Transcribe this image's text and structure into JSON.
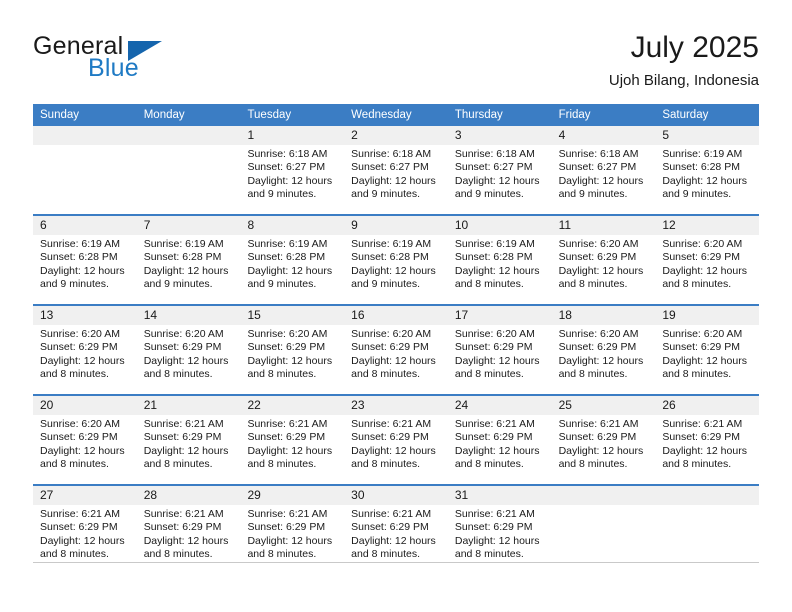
{
  "brand": {
    "name_top": "General",
    "name_bottom": "Blue",
    "triangle_icon": "triangle-icon",
    "color_dark": "#1a1a1a",
    "color_blue": "#1f7ac4"
  },
  "header": {
    "title": "July 2025",
    "subtitle": "Ujoh Bilang, Indonesia"
  },
  "calendar": {
    "header_bg": "#3b7dc4",
    "day_band_bg": "#f0f0f0",
    "weekdays": [
      "Sunday",
      "Monday",
      "Tuesday",
      "Wednesday",
      "Thursday",
      "Friday",
      "Saturday"
    ],
    "weeks": [
      [
        {
          "day": "",
          "sunrise": "",
          "sunset": "",
          "daylight_line1": "",
          "daylight_line2": ""
        },
        {
          "day": "",
          "sunrise": "",
          "sunset": "",
          "daylight_line1": "",
          "daylight_line2": ""
        },
        {
          "day": "1",
          "sunrise": "Sunrise: 6:18 AM",
          "sunset": "Sunset: 6:27 PM",
          "daylight_line1": "Daylight: 12 hours",
          "daylight_line2": "and 9 minutes."
        },
        {
          "day": "2",
          "sunrise": "Sunrise: 6:18 AM",
          "sunset": "Sunset: 6:27 PM",
          "daylight_line1": "Daylight: 12 hours",
          "daylight_line2": "and 9 minutes."
        },
        {
          "day": "3",
          "sunrise": "Sunrise: 6:18 AM",
          "sunset": "Sunset: 6:27 PM",
          "daylight_line1": "Daylight: 12 hours",
          "daylight_line2": "and 9 minutes."
        },
        {
          "day": "4",
          "sunrise": "Sunrise: 6:18 AM",
          "sunset": "Sunset: 6:27 PM",
          "daylight_line1": "Daylight: 12 hours",
          "daylight_line2": "and 9 minutes."
        },
        {
          "day": "5",
          "sunrise": "Sunrise: 6:19 AM",
          "sunset": "Sunset: 6:28 PM",
          "daylight_line1": "Daylight: 12 hours",
          "daylight_line2": "and 9 minutes."
        }
      ],
      [
        {
          "day": "6",
          "sunrise": "Sunrise: 6:19 AM",
          "sunset": "Sunset: 6:28 PM",
          "daylight_line1": "Daylight: 12 hours",
          "daylight_line2": "and 9 minutes."
        },
        {
          "day": "7",
          "sunrise": "Sunrise: 6:19 AM",
          "sunset": "Sunset: 6:28 PM",
          "daylight_line1": "Daylight: 12 hours",
          "daylight_line2": "and 9 minutes."
        },
        {
          "day": "8",
          "sunrise": "Sunrise: 6:19 AM",
          "sunset": "Sunset: 6:28 PM",
          "daylight_line1": "Daylight: 12 hours",
          "daylight_line2": "and 9 minutes."
        },
        {
          "day": "9",
          "sunrise": "Sunrise: 6:19 AM",
          "sunset": "Sunset: 6:28 PM",
          "daylight_line1": "Daylight: 12 hours",
          "daylight_line2": "and 9 minutes."
        },
        {
          "day": "10",
          "sunrise": "Sunrise: 6:19 AM",
          "sunset": "Sunset: 6:28 PM",
          "daylight_line1": "Daylight: 12 hours",
          "daylight_line2": "and 8 minutes."
        },
        {
          "day": "11",
          "sunrise": "Sunrise: 6:20 AM",
          "sunset": "Sunset: 6:29 PM",
          "daylight_line1": "Daylight: 12 hours",
          "daylight_line2": "and 8 minutes."
        },
        {
          "day": "12",
          "sunrise": "Sunrise: 6:20 AM",
          "sunset": "Sunset: 6:29 PM",
          "daylight_line1": "Daylight: 12 hours",
          "daylight_line2": "and 8 minutes."
        }
      ],
      [
        {
          "day": "13",
          "sunrise": "Sunrise: 6:20 AM",
          "sunset": "Sunset: 6:29 PM",
          "daylight_line1": "Daylight: 12 hours",
          "daylight_line2": "and 8 minutes."
        },
        {
          "day": "14",
          "sunrise": "Sunrise: 6:20 AM",
          "sunset": "Sunset: 6:29 PM",
          "daylight_line1": "Daylight: 12 hours",
          "daylight_line2": "and 8 minutes."
        },
        {
          "day": "15",
          "sunrise": "Sunrise: 6:20 AM",
          "sunset": "Sunset: 6:29 PM",
          "daylight_line1": "Daylight: 12 hours",
          "daylight_line2": "and 8 minutes."
        },
        {
          "day": "16",
          "sunrise": "Sunrise: 6:20 AM",
          "sunset": "Sunset: 6:29 PM",
          "daylight_line1": "Daylight: 12 hours",
          "daylight_line2": "and 8 minutes."
        },
        {
          "day": "17",
          "sunrise": "Sunrise: 6:20 AM",
          "sunset": "Sunset: 6:29 PM",
          "daylight_line1": "Daylight: 12 hours",
          "daylight_line2": "and 8 minutes."
        },
        {
          "day": "18",
          "sunrise": "Sunrise: 6:20 AM",
          "sunset": "Sunset: 6:29 PM",
          "daylight_line1": "Daylight: 12 hours",
          "daylight_line2": "and 8 minutes."
        },
        {
          "day": "19",
          "sunrise": "Sunrise: 6:20 AM",
          "sunset": "Sunset: 6:29 PM",
          "daylight_line1": "Daylight: 12 hours",
          "daylight_line2": "and 8 minutes."
        }
      ],
      [
        {
          "day": "20",
          "sunrise": "Sunrise: 6:20 AM",
          "sunset": "Sunset: 6:29 PM",
          "daylight_line1": "Daylight: 12 hours",
          "daylight_line2": "and 8 minutes."
        },
        {
          "day": "21",
          "sunrise": "Sunrise: 6:21 AM",
          "sunset": "Sunset: 6:29 PM",
          "daylight_line1": "Daylight: 12 hours",
          "daylight_line2": "and 8 minutes."
        },
        {
          "day": "22",
          "sunrise": "Sunrise: 6:21 AM",
          "sunset": "Sunset: 6:29 PM",
          "daylight_line1": "Daylight: 12 hours",
          "daylight_line2": "and 8 minutes."
        },
        {
          "day": "23",
          "sunrise": "Sunrise: 6:21 AM",
          "sunset": "Sunset: 6:29 PM",
          "daylight_line1": "Daylight: 12 hours",
          "daylight_line2": "and 8 minutes."
        },
        {
          "day": "24",
          "sunrise": "Sunrise: 6:21 AM",
          "sunset": "Sunset: 6:29 PM",
          "daylight_line1": "Daylight: 12 hours",
          "daylight_line2": "and 8 minutes."
        },
        {
          "day": "25",
          "sunrise": "Sunrise: 6:21 AM",
          "sunset": "Sunset: 6:29 PM",
          "daylight_line1": "Daylight: 12 hours",
          "daylight_line2": "and 8 minutes."
        },
        {
          "day": "26",
          "sunrise": "Sunrise: 6:21 AM",
          "sunset": "Sunset: 6:29 PM",
          "daylight_line1": "Daylight: 12 hours",
          "daylight_line2": "and 8 minutes."
        }
      ],
      [
        {
          "day": "27",
          "sunrise": "Sunrise: 6:21 AM",
          "sunset": "Sunset: 6:29 PM",
          "daylight_line1": "Daylight: 12 hours",
          "daylight_line2": "and 8 minutes."
        },
        {
          "day": "28",
          "sunrise": "Sunrise: 6:21 AM",
          "sunset": "Sunset: 6:29 PM",
          "daylight_line1": "Daylight: 12 hours",
          "daylight_line2": "and 8 minutes."
        },
        {
          "day": "29",
          "sunrise": "Sunrise: 6:21 AM",
          "sunset": "Sunset: 6:29 PM",
          "daylight_line1": "Daylight: 12 hours",
          "daylight_line2": "and 8 minutes."
        },
        {
          "day": "30",
          "sunrise": "Sunrise: 6:21 AM",
          "sunset": "Sunset: 6:29 PM",
          "daylight_line1": "Daylight: 12 hours",
          "daylight_line2": "and 8 minutes."
        },
        {
          "day": "31",
          "sunrise": "Sunrise: 6:21 AM",
          "sunset": "Sunset: 6:29 PM",
          "daylight_line1": "Daylight: 12 hours",
          "daylight_line2": "and 8 minutes."
        },
        {
          "day": "",
          "sunrise": "",
          "sunset": "",
          "daylight_line1": "",
          "daylight_line2": ""
        },
        {
          "day": "",
          "sunrise": "",
          "sunset": "",
          "daylight_line1": "",
          "daylight_line2": ""
        }
      ]
    ]
  }
}
